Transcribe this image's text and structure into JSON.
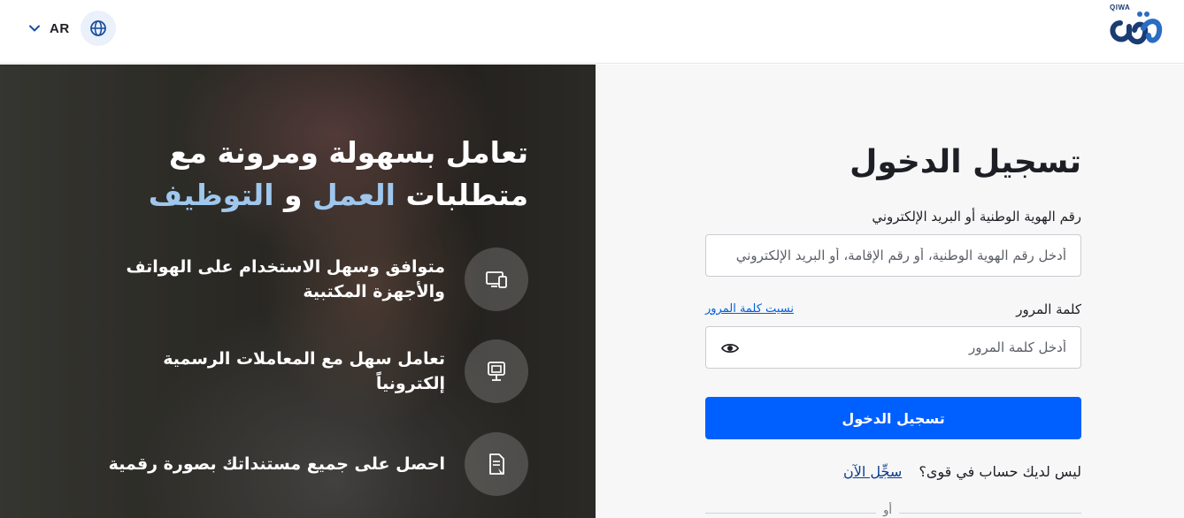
{
  "header": {
    "language_label": "AR",
    "logo_small_text": "QIWA"
  },
  "hero": {
    "title_line1": "تعامل بسهولة ومرونة مع",
    "title_line2_prefix": "متطلبات",
    "title_line2_accent1": "العمل",
    "title_line2_mid": "و",
    "title_line2_accent2": "التوظيف",
    "features": [
      {
        "icon": "devices-icon",
        "text": "متوافق وسهل الاستخدام على الهواتف والأجهزة المكتبية"
      },
      {
        "icon": "transactions-icon",
        "text": "تعامل سهل مع المعاملات الرسمية إلكترونياً"
      },
      {
        "icon": "document-icon",
        "text": "احصل على جميع مستنداتك بصورة رقمية"
      }
    ]
  },
  "form": {
    "title": "تسجيل الدخول",
    "id_label": "رقم الهوية الوطنية أو البريد الإلكتروني",
    "id_placeholder": "أدخل رقم الهوية الوطنية، أو رقم الإقامة، أو البريد الإلكتروني",
    "password_label": "كلمة المرور",
    "forgot_password": "نسيت كلمة المرور",
    "password_placeholder": "أدخل كلمة المرور",
    "submit_label": "تسجيل الدخول",
    "no_account_text": "ليس لديك حساب في قوى؟",
    "register_link": "سجِّل الآن",
    "or_text": "أو"
  },
  "colors": {
    "primary": "#0060ff",
    "accent_text": "#9fc7ee",
    "logo": "#1b3c73"
  }
}
